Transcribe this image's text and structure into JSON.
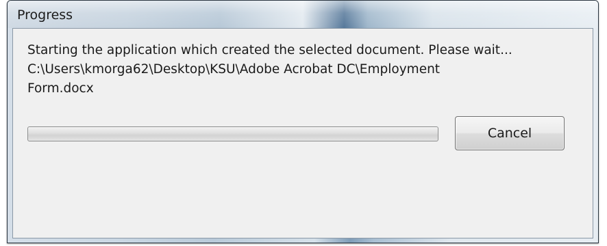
{
  "dialog": {
    "title": "Progress",
    "message_line1": "Starting the application which created the selected document. Please wait...",
    "message_line2": "C:\\Users\\kmorga62\\Desktop\\KSU\\Adobe Acrobat DC\\Employment",
    "message_line3": "Form.docx",
    "progress_fraction": 0,
    "cancel_label": "Cancel"
  }
}
